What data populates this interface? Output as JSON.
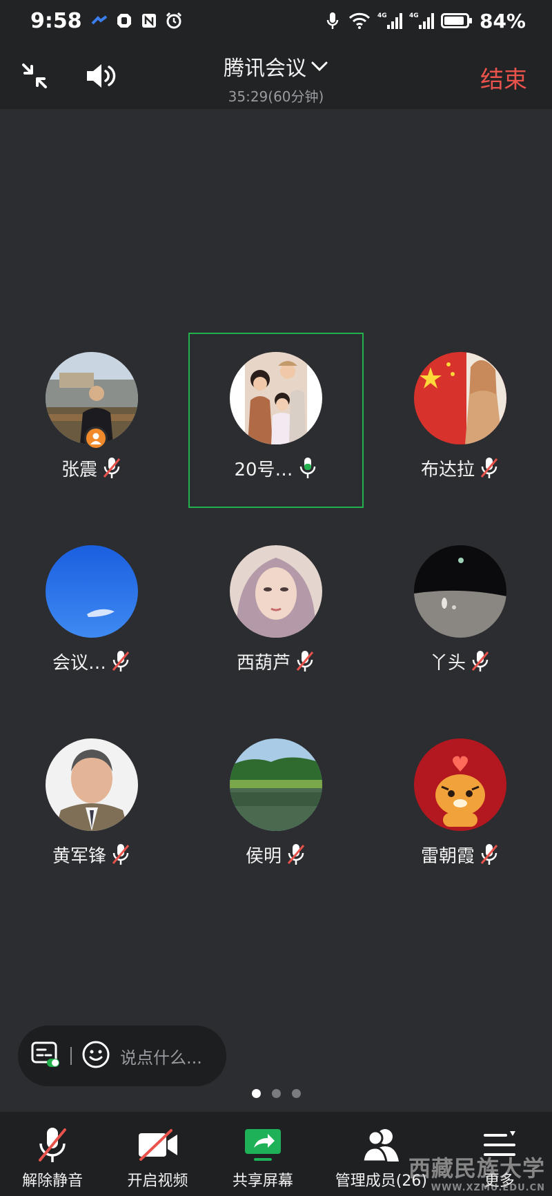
{
  "status_bar": {
    "time": "9:58",
    "battery_percent": "84%",
    "network_label": "4G"
  },
  "header": {
    "title": "腾讯会议",
    "subtitle": "35:29(60分钟)",
    "end_label": "结束"
  },
  "participants": [
    {
      "name": "张震",
      "muted": true,
      "host": true,
      "speaking": false
    },
    {
      "name": "20号…",
      "muted": false,
      "host": false,
      "speaking": true
    },
    {
      "name": "布达拉",
      "muted": true,
      "host": false,
      "speaking": false
    },
    {
      "name": "会议…",
      "muted": true,
      "host": false,
      "speaking": false
    },
    {
      "name": "西葫芦",
      "muted": true,
      "host": false,
      "speaking": false
    },
    {
      "name": "丫头",
      "muted": true,
      "host": false,
      "speaking": false
    },
    {
      "name": "黄军锋",
      "muted": true,
      "host": false,
      "speaking": false
    },
    {
      "name": "侯明",
      "muted": true,
      "host": false,
      "speaking": false
    },
    {
      "name": "雷朝霞",
      "muted": true,
      "host": false,
      "speaking": false
    }
  ],
  "chat": {
    "placeholder": "说点什么..."
  },
  "pagination": {
    "current_page": 1,
    "total_pages": 3
  },
  "toolbar": {
    "unmute_label": "解除静音",
    "video_label": "开启视频",
    "share_label": "共享屏幕",
    "members_label": "管理成员(26)",
    "more_label": "更多"
  },
  "watermark": {
    "text": "西藏民族大学",
    "url": "WWW.XZMU.EDU.CN"
  },
  "colors": {
    "background": "#2c2d30",
    "end_red": "#e9534b",
    "active_green": "#22b14c",
    "share_green": "#1fb158",
    "mute_red": "#e9534b"
  }
}
